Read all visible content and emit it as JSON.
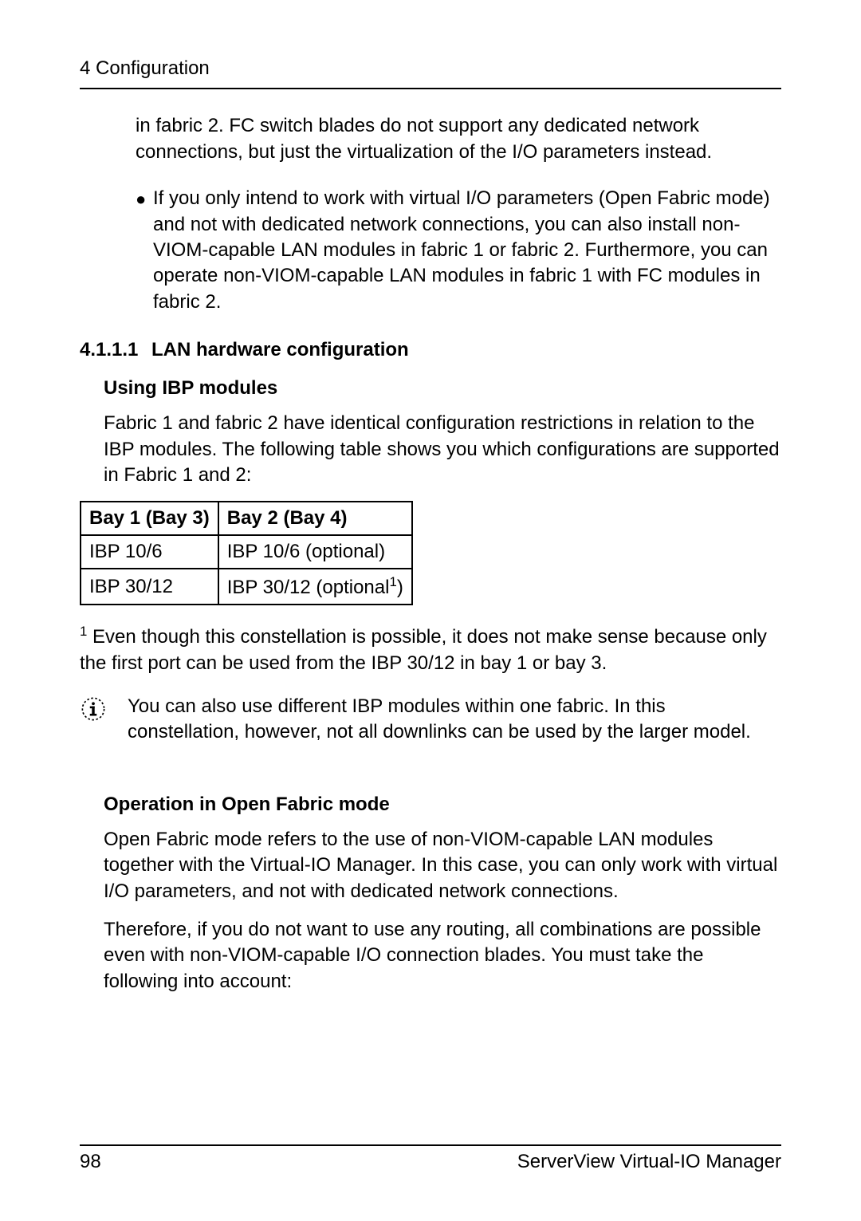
{
  "header": {
    "title": "4 Configuration"
  },
  "content": {
    "para1": "in fabric 2. FC switch blades do not support any dedicated network connections, but just the virtualization of the I/O parameters instead.",
    "bullet1": "If you only intend to work with virtual I/O parameters (Open Fabric mode) and not with dedicated network connections, you can also install non-VIOM-capable LAN modules in fabric 1 or fabric 2. Furthermore, you can operate non-VIOM-capable LAN modules in fabric 1 with FC modules in fabric 2.",
    "section_num": "4.1.1.1",
    "section_heading": "LAN hardware configuration",
    "sub1_heading": "Using IBP modules",
    "sub1_para": "Fabric 1 and fabric 2 have identical configuration restrictions in relation to the IBP modules. The following table shows you which configurations are supported in Fabric 1 and 2:",
    "table": {
      "h1": "Bay 1 (Bay 3)",
      "h2": "Bay 2 (Bay 4)",
      "r1c1": "IBP 10/6",
      "r1c2": "IBP 10/6 (optional)",
      "r2c1": "IBP 30/12",
      "r2c2_pre": "IBP 30/12 (optional",
      "r2c2_post": ")"
    },
    "footnote_marker": "1",
    "footnote_text": " Even though this constellation is possible, it does not make sense because only the first port can be used from the IBP 30/12 in bay 1 or bay 3.",
    "info_text": "You can also use different IBP modules within one fabric. In this constellation, however, not all downlinks can be used by the larger model.",
    "sub2_heading": "Operation in Open Fabric mode",
    "sub2_para1": "Open Fabric mode refers to the use of non-VIOM-capable LAN modules together with the Virtual-IO Manager. In this case, you can only work with virtual I/O parameters, and not with dedicated network connections.",
    "sub2_para2": "Therefore, if you do not want to use any routing, all combinations are possible even with non-VIOM-capable I/O connection blades. You must take the following into account:"
  },
  "footer": {
    "page_number": "98",
    "product": "ServerView Virtual-IO Manager"
  }
}
